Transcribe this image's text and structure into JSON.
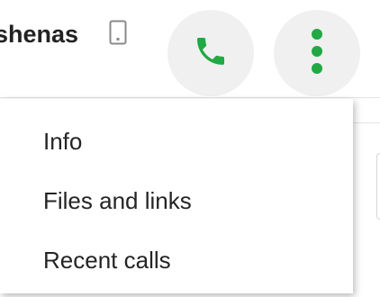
{
  "header": {
    "contact_name": "shenas",
    "device_icon": "phone-device-icon",
    "call_icon": "phone-call-icon",
    "more_icon": "more-vertical-icon",
    "accent_color": "#22a845"
  },
  "menu": {
    "items": [
      {
        "label": "Info"
      },
      {
        "label": "Files and links"
      },
      {
        "label": "Recent calls"
      }
    ]
  }
}
